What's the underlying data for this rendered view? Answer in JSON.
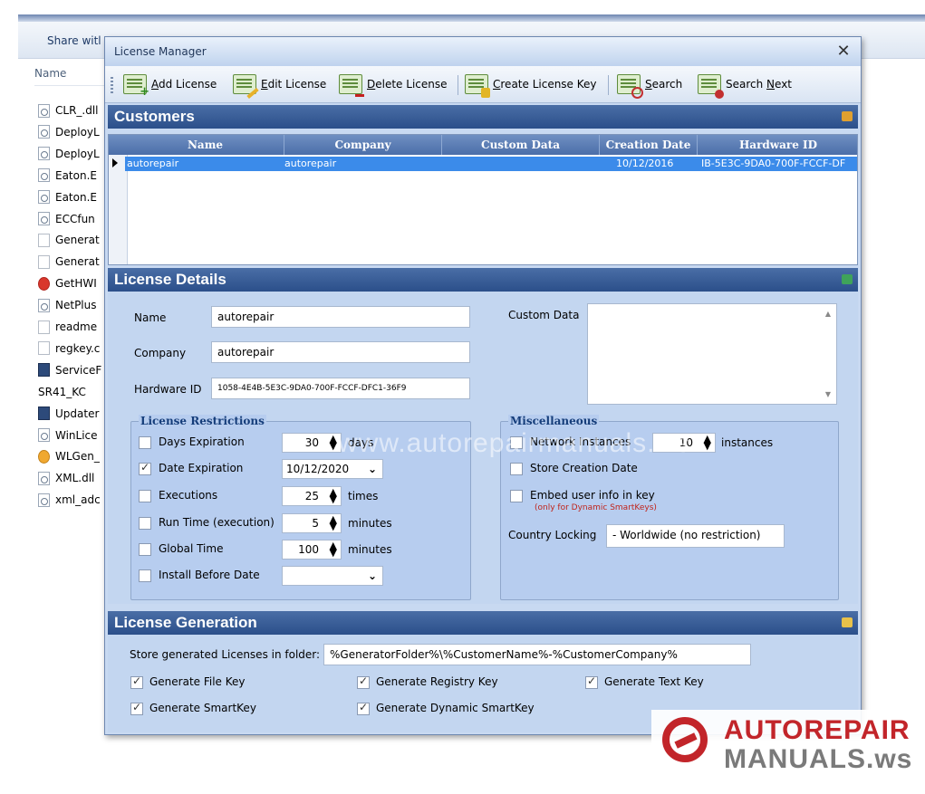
{
  "explorer": {
    "toolbar_share": "Share witl",
    "column_name": "Name",
    "files": [
      {
        "name": "CLR_.dll",
        "icon": "dll"
      },
      {
        "name": "DeployL",
        "icon": "dll"
      },
      {
        "name": "DeployL",
        "icon": "dll"
      },
      {
        "name": "Eaton.E",
        "icon": "dll"
      },
      {
        "name": "Eaton.E",
        "icon": "dll"
      },
      {
        "name": "ECCfun",
        "icon": "dll"
      },
      {
        "name": "Generat",
        "icon": "txt"
      },
      {
        "name": "Generat",
        "icon": "txt"
      },
      {
        "name": "GetHWI",
        "icon": "red"
      },
      {
        "name": "NetPlus",
        "icon": "dll"
      },
      {
        "name": "readme",
        "icon": "txt"
      },
      {
        "name": "regkey.c",
        "icon": "txt"
      },
      {
        "name": "ServiceF",
        "icon": "monitor"
      },
      {
        "name": "SR41_KC",
        "icon": "grid"
      },
      {
        "name": "Updater",
        "icon": "monitor"
      },
      {
        "name": "WinLice",
        "icon": "dll"
      },
      {
        "name": "WLGen_",
        "icon": "orange"
      },
      {
        "name": "XML.dll",
        "icon": "dll"
      },
      {
        "name": "xml_adc",
        "icon": "dll"
      }
    ]
  },
  "window": {
    "title": "License Manager",
    "close_glyph": "✕"
  },
  "toolbar": {
    "add": {
      "mn": "A",
      "rest": "dd License"
    },
    "edit": {
      "mn": "E",
      "rest": "dit License"
    },
    "delete": {
      "mn": "D",
      "rest": "elete License"
    },
    "create": {
      "mn": "C",
      "rest": "reate License Key"
    },
    "search": {
      "mn": "S",
      "rest": "earch"
    },
    "search_next": {
      "pre": "Search ",
      "mn": "N",
      "rest": "ext"
    }
  },
  "customers": {
    "title": "Customers",
    "columns": [
      "Name",
      "Company",
      "Custom Data",
      "Creation Date",
      "Hardware ID"
    ],
    "rows": [
      {
        "name": "autorepair",
        "company": "autorepair",
        "custom": "",
        "date": "10/12/2016",
        "hwid": "IB-5E3C-9DA0-700F-FCCF-DF"
      }
    ]
  },
  "details": {
    "title": "License Details",
    "name_label": "Name",
    "name_value": "autorepair",
    "company_label": "Company",
    "company_value": "autorepair",
    "hwid_label": "Hardware ID",
    "hwid_value": "1058-4E4B-5E3C-9DA0-700F-FCCF-DFC1-36F9",
    "custom_label": "Custom Data",
    "watermark": "www.autorepairmanuals.ws"
  },
  "restrictions": {
    "title": "License Restrictions",
    "days_label": "Days Expiration",
    "days_value": "30",
    "days_unit": "days",
    "days_checked": false,
    "date_label": "Date Expiration",
    "date_value": "10/12/2020",
    "date_checked": true,
    "exec_label": "Executions",
    "exec_value": "25",
    "exec_unit": "times",
    "exec_checked": false,
    "run_label": "Run Time (execution)",
    "run_value": "5",
    "run_unit": "minutes",
    "run_checked": false,
    "global_label": "Global Time",
    "global_value": "100",
    "global_unit": "minutes",
    "global_checked": false,
    "install_label": "Install Before Date",
    "install_value": "",
    "install_checked": false
  },
  "misc": {
    "title": "Miscellaneous",
    "network_label": "Network Instances",
    "network_value": "10",
    "network_unit": "instances",
    "network_checked": false,
    "store_label": "Store Creation Date",
    "store_checked": false,
    "embed_label": "Embed user info in key",
    "embed_note": "(only for Dynamic SmartKeys)",
    "embed_checked": false,
    "country_label": "Country Locking",
    "country_value": "- Worldwide (no restriction)"
  },
  "generation": {
    "title": "License Generation",
    "folder_label": "Store generated Licenses in folder:",
    "folder_value": "%GeneratorFolder%\\%CustomerName%-%CustomerCompany%",
    "file_key": "Generate File Key",
    "registry_key": "Generate Registry Key",
    "text_key": "Generate Text Key",
    "smart_key": "Generate SmartKey",
    "dynamic_key": "Generate Dynamic SmartKey"
  },
  "logo": {
    "line1": "AUTOREPAIR",
    "line2": "MANUALS.ws"
  },
  "colors": {
    "section_header": "#2b4f8a",
    "selected_row": "#3b8bea",
    "group_title": "#153d7a",
    "logo_red": "#c2252a"
  }
}
